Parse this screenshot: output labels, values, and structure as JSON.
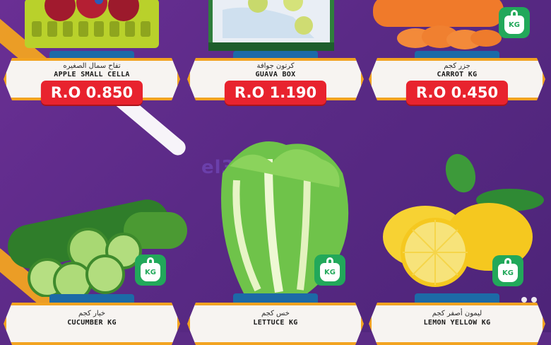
{
  "watermark": "el3rod.com",
  "products": [
    {
      "name_ar": "تفاح سمال الصغيره",
      "name_en": "APPLE SMALL CELLA",
      "price": "R.O 0.850"
    },
    {
      "name_ar": "كرتون جوافة",
      "name_en": "GUAVA BOX",
      "price": "R.O 1.190"
    },
    {
      "name_ar": "جزر كجم",
      "name_en": "CARROT KG",
      "price": "R.O 0.450",
      "unit": "KG"
    },
    {
      "name_ar": "خيار كجم",
      "name_en": "CUCUMBER KG",
      "unit": "KG"
    },
    {
      "name_ar": "خس كجم",
      "name_en": "LETTUCE KG",
      "unit": "KG"
    },
    {
      "name_ar": "ليمون أصفر كجم",
      "name_en": "LEMON YELLOW KG",
      "unit": "KG"
    }
  ],
  "colors": {
    "background": "#5b2b86",
    "price_bg": "#e8232e",
    "frame": "#f2a321",
    "kg_badge": "#22a85a",
    "shelf": "#1c6aa7"
  }
}
